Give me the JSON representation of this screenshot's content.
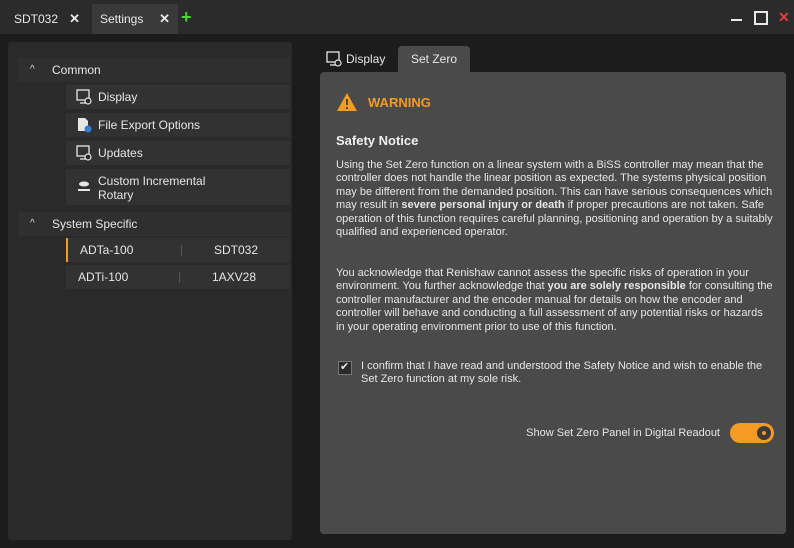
{
  "tabs": [
    {
      "label": "SDT032",
      "close": "✕"
    },
    {
      "label": "Settings",
      "close": "✕"
    }
  ],
  "add_tab": "+",
  "window": {
    "close": "✕"
  },
  "sidebar": {
    "sections": [
      {
        "title": "Common",
        "chevron": "^"
      },
      {
        "title": "System Specific",
        "chevron": "^"
      }
    ],
    "common_items": [
      {
        "label": "Display",
        "icon": "display-settings-icon"
      },
      {
        "label": "File Export Options",
        "icon": "file-export-icon"
      },
      {
        "label": "Updates",
        "icon": "updates-icon"
      },
      {
        "label": "Custom Incremental Rotary",
        "icon": "rotary-icon"
      }
    ],
    "devices": [
      {
        "name": "ADTa-100",
        "serial": "SDT032",
        "selected": true
      },
      {
        "name": "ADTi-100",
        "serial": "1AXV28",
        "selected": false
      }
    ]
  },
  "right_tabs": [
    "Display",
    "Set Zero"
  ],
  "warning": {
    "title": "WARNING",
    "notice_title": "Safety Notice",
    "p1_a": "Using the Set Zero function on a linear system with a BiSS controller may mean that the controller does not handle the linear position as expected. The systems physical position may be different from the demanded position. This can have serious consequences which may result in ",
    "p1_bold": "severe personal injury or death",
    "p1_b": " if proper precautions are not taken. Safe operation of this function requires careful planning, positioning and operation by a suitably qualified and experienced operator.",
    "p2_a": "You acknowledge that Renishaw cannot assess the specific risks of operation in your environment. You further acknowledge that ",
    "p2_bold": "you are solely responsible",
    "p2_b": " for consulting the controller manufacturer and the encoder manual for details on how the encoder and controller will behave and conducting a full assessment of any potential risks or hazards in your operating environment prior to use of this function.",
    "confirm_text": "I confirm that I have read and understood the Safety Notice and wish to enable the Set Zero function at my sole risk.",
    "confirm_checked": true,
    "toggle_label": "Show Set Zero Panel in Digital Readout",
    "toggle_on": true
  },
  "colors": {
    "accent": "#f59a23",
    "close_red": "#e03c3c",
    "add_green": "#4cd137"
  }
}
